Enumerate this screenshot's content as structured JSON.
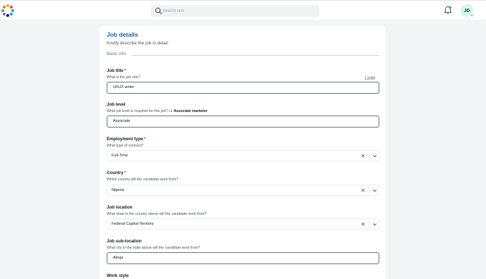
{
  "header": {
    "search_placeholder": "Search hint",
    "avatar_initials": "JD"
  },
  "logo": {
    "dot_colors": [
      "#f59e0b",
      "#ef4444",
      "#10b981",
      "#3b82f6",
      "#111827",
      "#8b5cf6",
      "#22c55e",
      "#f97316"
    ]
  },
  "form": {
    "title": "Job details",
    "subtitle": "Kindly describe the job in detail",
    "section_label": "Basic info",
    "required_mark": "*",
    "job_title": {
      "label": "Job title",
      "hint": "What is the job role?",
      "counter": "12/60",
      "value": "UI/UX writer"
    },
    "job_level": {
      "label": "Job level",
      "hint_prefix": "What job level is required for this job? i.e ",
      "hint_example": "Associate marketer",
      "value": "Associate"
    },
    "employment_type": {
      "label": "Employment type",
      "hint": "What type of contract?",
      "value": "Full-Time"
    },
    "country": {
      "label": "Country",
      "hint": "Which country will the candidate work from?",
      "value": "Nigeria"
    },
    "job_location": {
      "label": "Job location",
      "hint": "What state in the country above will the candidate work from?",
      "value": "Federal Capital Territory"
    },
    "job_sublocation": {
      "label": "Job sub-location",
      "hint": "What city in the state above will the candidate work from?",
      "value": "Abuja"
    },
    "work_style": {
      "label": "Work style"
    }
  }
}
